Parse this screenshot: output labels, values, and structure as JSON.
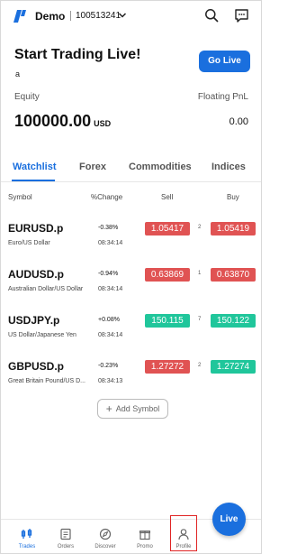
{
  "header": {
    "account_type": "Demo",
    "account_number": "100513241"
  },
  "promo": {
    "title": "Start Trading Live!",
    "subtitle": "a",
    "go_live_label": "Go Live"
  },
  "summary": {
    "equity_label": "Equity",
    "equity_value": "100000.00",
    "equity_unit": "USD",
    "floating_label": "Floating PnL",
    "floating_value": "0.00"
  },
  "tabs": [
    "Watchlist",
    "Forex",
    "Commodities",
    "Indices"
  ],
  "columns": {
    "symbol": "Symbol",
    "change": "%Change",
    "sell": "Sell",
    "buy": "Buy"
  },
  "rows": [
    {
      "symbol": "EURUSD.p",
      "desc": "Euro/US Dollar",
      "change": "-0.38%",
      "time": "08:34:14",
      "sell": "1.05417",
      "spread": "2",
      "buy": "1.05419",
      "color": "#e05353"
    },
    {
      "symbol": "AUDUSD.p",
      "desc": "Australian Dollar/US Dollar",
      "change": "-0.94%",
      "time": "08:34:14",
      "sell": "0.63869",
      "spread": "1",
      "buy": "0.63870",
      "color": "#e05353"
    },
    {
      "symbol": "USDJPY.p",
      "desc": "US Dollar/Japanese Yen",
      "change": "+0.08%",
      "time": "08:34:14",
      "sell": "150.115",
      "spread": "7",
      "buy": "150.122",
      "color": "#20c69b"
    },
    {
      "symbol": "GBPUSD.p",
      "desc": "Great Britain Pound/US D...",
      "change": "-0.23%",
      "time": "08:34:13",
      "sell": "1.27272",
      "spread": "2",
      "buy": "1.27274",
      "color": "#e05353 / #20c69b"
    }
  ],
  "add_symbol_label": "Add Symbol",
  "nav": {
    "trades": "Trades",
    "orders": "Orders",
    "discover": "Discover",
    "promo": "Promo",
    "profile": "Profile",
    "live": "Live"
  },
  "colors": {
    "accent": "#1a6fde",
    "sell_down": "#e05353",
    "up": "#20c69b",
    "highlight_box": "#e02424"
  }
}
